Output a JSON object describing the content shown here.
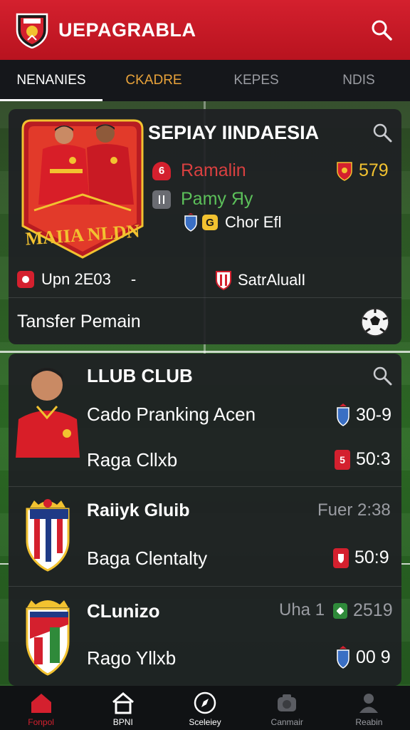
{
  "header": {
    "title": "UEPAGRABLA"
  },
  "tabs": [
    {
      "label": "NENANIES"
    },
    {
      "label": "CKADRE"
    },
    {
      "label": "KEPES"
    },
    {
      "label": "NDIS"
    }
  ],
  "feature": {
    "badge_text": "MAIIA NLDN",
    "title": "SEPIAY IINDAESIA",
    "stat1_label": "Ramalin",
    "stat1_value": "579",
    "stat2_label": "Pamy Яy",
    "stat3_label": "Chor Efl",
    "stat3_chip": "G",
    "date_text": "Upn 2E03",
    "dash": "-",
    "club_text": "SatrAlualI",
    "transfer_label": "Tansfer Pemain"
  },
  "list": {
    "section1": {
      "title": "LLUB CLUB",
      "row1_text": "Cado Pranking Acen",
      "row1_score": "30-9",
      "row2_text": "Raga Cllxb",
      "row2_chip": "5",
      "row2_score": "50:3"
    },
    "section2": {
      "title": "Raiiyk Gluib",
      "meta": "Fuer 2:38",
      "row_text": "Baga Clentalty",
      "row_score": "50:9"
    },
    "section3": {
      "title": "CLunizo",
      "meta": "Uha 1",
      "meta_score": "2519",
      "row_text": "Rago Yllxb",
      "row_score": "00 9"
    }
  },
  "bottom_nav": [
    {
      "label": "Fonpol"
    },
    {
      "label": "BPNI"
    },
    {
      "label": "Sceleiey"
    },
    {
      "label": "Canmair"
    },
    {
      "label": "Reabin"
    }
  ],
  "colors": {
    "brand_red": "#d4202e",
    "accent_orange": "#e8a23a",
    "stat_red": "#d94040",
    "stat_green": "#5cc05a",
    "score_yellow": "#f2c230"
  }
}
